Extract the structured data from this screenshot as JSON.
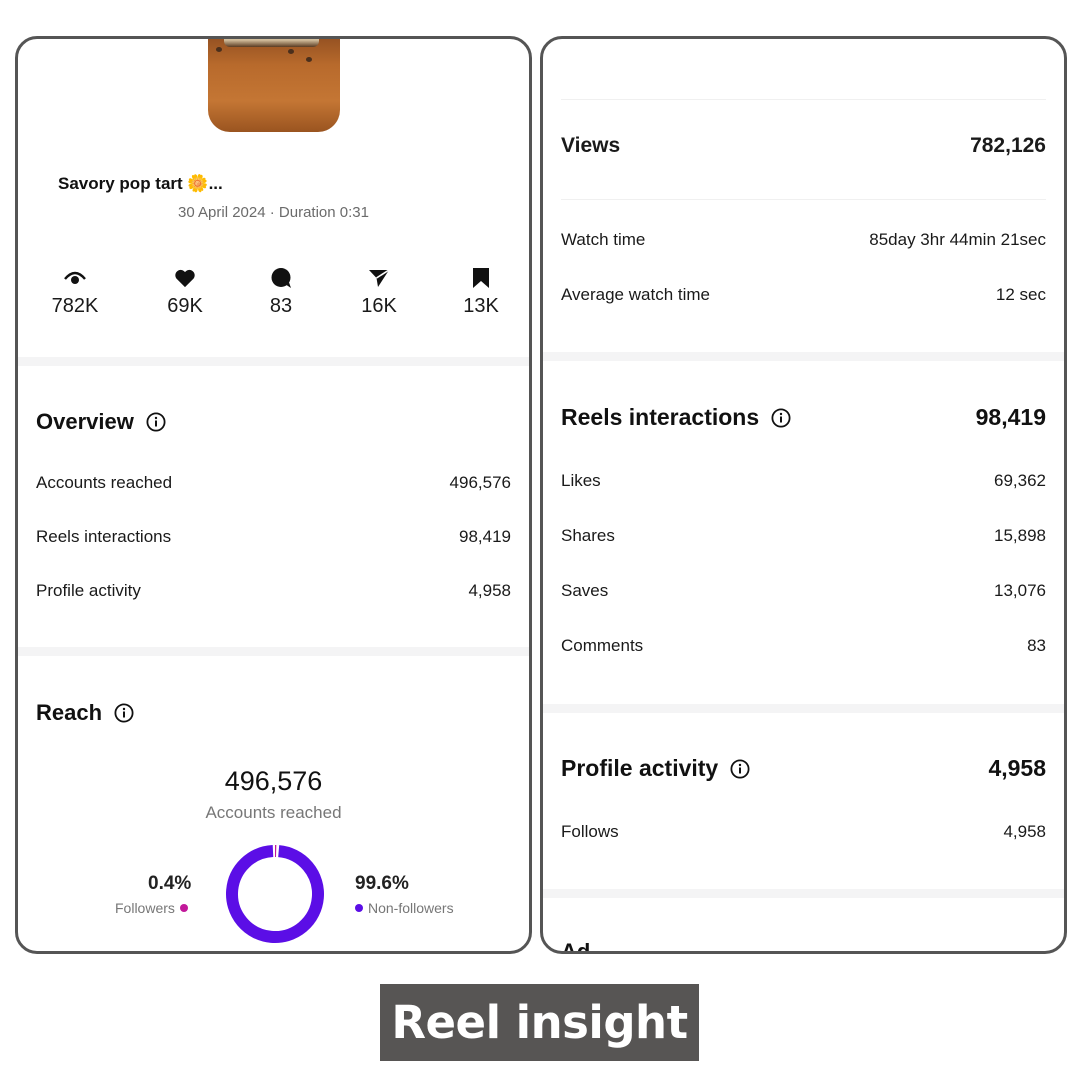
{
  "reel": {
    "title": "Savory pop tart 🌼...",
    "meta": "30 April 2024 · Duration 0:31",
    "stats": [
      {
        "icon": "eye-icon",
        "value": "782K"
      },
      {
        "icon": "heart-icon",
        "value": "69K"
      },
      {
        "icon": "comment-icon",
        "value": "83"
      },
      {
        "icon": "share-icon",
        "value": "16K"
      },
      {
        "icon": "bookmark-icon",
        "value": "13K"
      }
    ]
  },
  "overview": {
    "title": "Overview",
    "rows": [
      {
        "label": "Accounts reached",
        "value": "496,576"
      },
      {
        "label": "Reels interactions",
        "value": "98,419"
      },
      {
        "label": "Profile activity",
        "value": "4,958"
      }
    ]
  },
  "reach": {
    "title": "Reach",
    "total": "496,576",
    "total_label": "Accounts reached",
    "followers_pct": "0.4%",
    "followers_label": "Followers",
    "followers_fraction": 0.004,
    "nonfollowers_pct": "99.6%",
    "nonfollowers_label": "Non-followers",
    "followers_color": "#c2189a",
    "nonfollowers_color": "#5b0ee6"
  },
  "views": {
    "label": "Views",
    "value": "782,126",
    "rows": [
      {
        "label": "Watch time",
        "value": "85day 3hr 44min 21sec"
      },
      {
        "label": "Average watch time",
        "value": "12 sec"
      }
    ]
  },
  "interactions": {
    "title": "Reels interactions",
    "total": "98,419",
    "rows": [
      {
        "label": "Likes",
        "value": "69,362"
      },
      {
        "label": "Shares",
        "value": "15,898"
      },
      {
        "label": "Saves",
        "value": "13,076"
      },
      {
        "label": "Comments",
        "value": "83"
      }
    ]
  },
  "profile_activity": {
    "title": "Profile activity",
    "total": "4,958",
    "rows": [
      {
        "label": "Follows",
        "value": "4,958"
      }
    ]
  },
  "next_section_partial": "Ad",
  "banner": "Reel insight"
}
